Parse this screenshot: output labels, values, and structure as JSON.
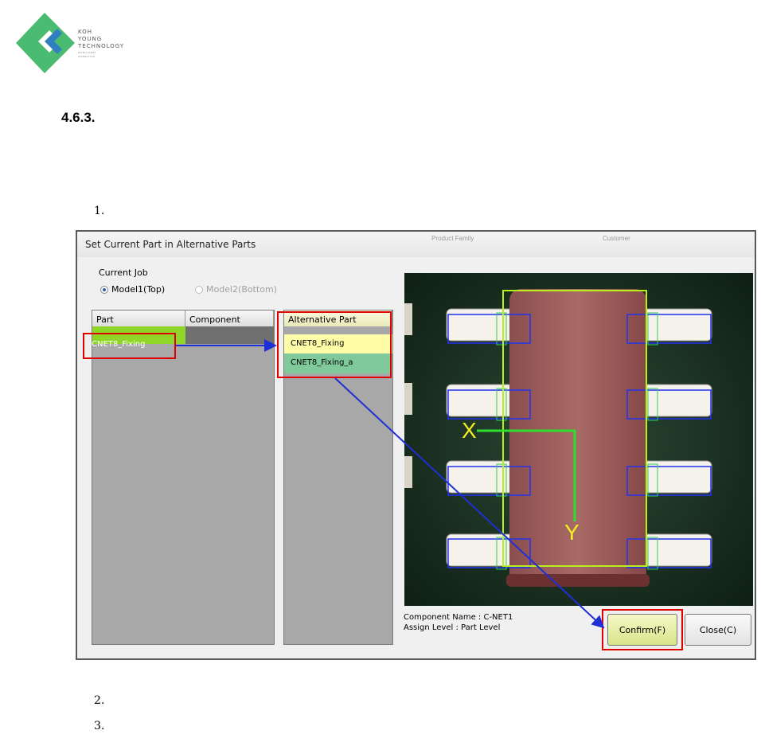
{
  "logo": {
    "line1": "KOH",
    "line2": "YOUNG",
    "line3": "TECHNOLOGY",
    "tagline1": "INTELLIGENT",
    "tagline2": "INSPECTION",
    "colors": {
      "green": "#4cbb72",
      "blue": "#2f7fc1"
    }
  },
  "section_number": "4.6.3.",
  "steps": [
    "1.",
    "2.",
    "3."
  ],
  "dialog": {
    "title": "Set Current Part in Alternative Parts",
    "background_tabs": [
      "Product Family",
      "Customer"
    ],
    "current_job_label": "Current Job",
    "radio_top": "Model1(Top)",
    "radio_bottom": "Model2(Bottom)",
    "parts_table": {
      "headers": [
        "Part",
        "Component"
      ],
      "rows": [
        [
          "CNET8_Fixing",
          ""
        ]
      ]
    },
    "alternative_table": {
      "header": "Alternative Part",
      "rows": [
        "CNET8_Fixing",
        "CNET8_Fixing_a"
      ]
    },
    "axis_x": "X",
    "axis_y": "Y",
    "component_name": "Component Name : C-NET1",
    "assign_level": "Assign Level : Part Level",
    "confirm_button": "Confirm(F)",
    "close_button": "Close(C)"
  }
}
